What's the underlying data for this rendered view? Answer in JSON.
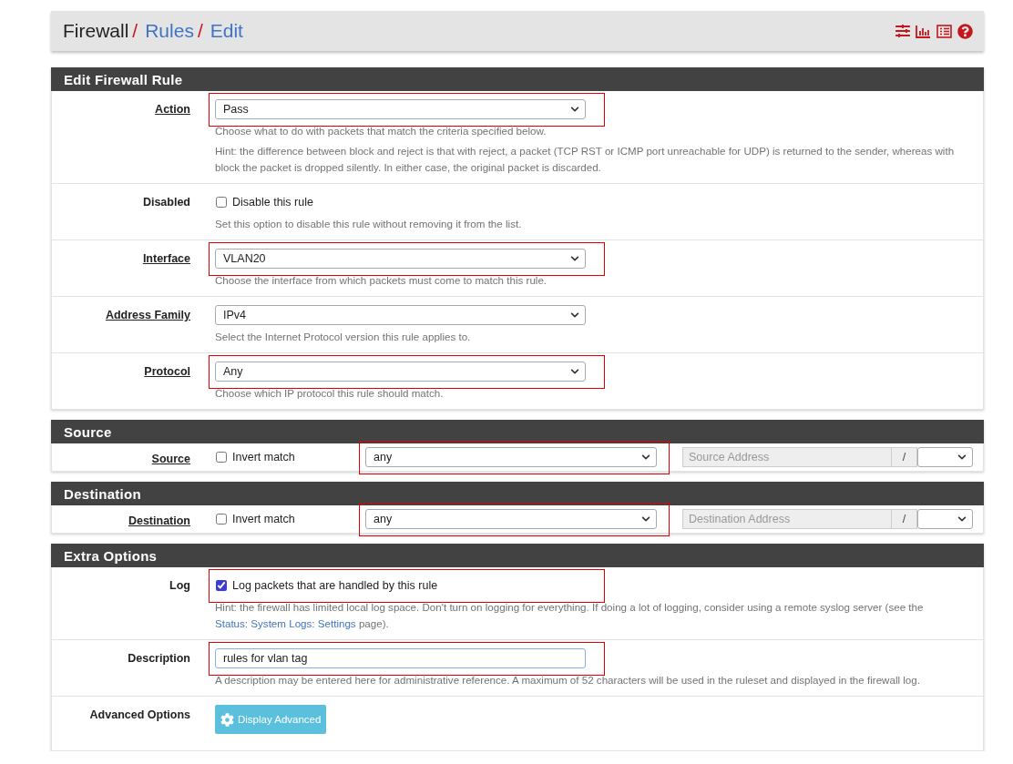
{
  "breadcrumb": [
    {
      "text": "Firewall",
      "link": false,
      "separator": "/"
    },
    {
      "text": "Rules",
      "link": true,
      "separator": "/"
    },
    {
      "text": "Edit",
      "link": true
    }
  ],
  "sections": [
    {
      "title": "Edit Firewall Rule",
      "rows": [
        {
          "kind": "select",
          "label": "Action",
          "required": true,
          "value": "Pass",
          "highlighted": true,
          "help": [
            [
              {
                "text": "Choose what to do with packets that match the criteria specified below."
              }
            ],
            [
              {
                "text": "Hint: the difference between block and reject is that with reject, a packet (TCP RST or ICMP port unreachable for UDP) is returned to the sender, whereas with block the packet is dropped silently. In either case, the original packet is discarded."
              }
            ]
          ]
        },
        {
          "kind": "checkbox",
          "label": "Disabled",
          "required": false,
          "option": "Disable this rule",
          "checked": false,
          "highlighted": false,
          "help": [
            [
              {
                "text": "Set this option to disable this rule without removing it from the list."
              }
            ]
          ]
        },
        {
          "kind": "select",
          "label": "Interface",
          "required": true,
          "value": "VLAN20",
          "highlighted": true,
          "help": [
            [
              {
                "text": "Choose the interface from which packets must come to match this rule."
              }
            ]
          ]
        },
        {
          "kind": "select",
          "label": "Address Family",
          "required": true,
          "value": "IPv4",
          "highlighted": false,
          "help": [
            [
              {
                "text": "Select the Internet Protocol version this rule applies to."
              }
            ]
          ]
        },
        {
          "kind": "select",
          "label": "Protocol",
          "required": true,
          "value": "Any",
          "highlighted": true,
          "help": [
            [
              {
                "text": "Choose which IP protocol this rule should match."
              }
            ]
          ]
        }
      ]
    },
    {
      "title": "Source",
      "rows": [
        {
          "kind": "address",
          "label": "Source",
          "required": true,
          "option": "Invert match",
          "checked": false,
          "value": "any",
          "highlighted": true,
          "placeholder": "Source Address",
          "slash": "/"
        }
      ]
    },
    {
      "title": "Destination",
      "rows": [
        {
          "kind": "address",
          "label": "Destination",
          "required": true,
          "option": "Invert match",
          "checked": false,
          "value": "any",
          "highlighted": true,
          "placeholder": "Destination Address",
          "slash": "/"
        }
      ]
    },
    {
      "title": "Extra Options",
      "rows": [
        {
          "kind": "checkbox",
          "label": "Log",
          "required": false,
          "option": "Log packets that are handled by this rule",
          "checked": true,
          "highlighted": true,
          "help": [
            [
              {
                "text": "Hint: the firewall has limited local log space. Don't turn on logging for everything. If doing a lot of logging, consider using a remote syslog server (see the "
              },
              {
                "text": "Status: System Logs: Settings",
                "link": true
              },
              {
                "text": " page)."
              }
            ]
          ]
        },
        {
          "kind": "text",
          "label": "Description",
          "required": false,
          "value": "rules for vlan tag",
          "highlighted": true,
          "help": [
            [
              {
                "text": "A description may be entered here for administrative reference. A maximum of 52 characters will be used in the ruleset and displayed in the firewall log."
              }
            ]
          ]
        },
        {
          "kind": "button",
          "label": "Advanced Options",
          "required": false,
          "button": "Display Advanced"
        }
      ]
    }
  ]
}
